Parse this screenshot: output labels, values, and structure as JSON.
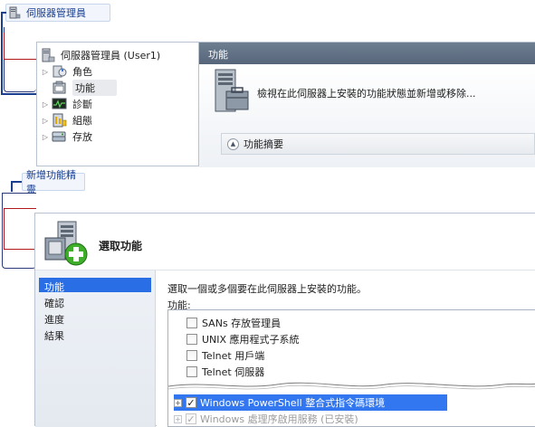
{
  "callout_top": {
    "label": "伺服器管理員"
  },
  "callout_bottom": {
    "label": "新增功能精靈"
  },
  "tree": {
    "root_label": "伺服器管理員 (User1)",
    "items": [
      {
        "label": "角色"
      },
      {
        "label": "功能"
      },
      {
        "label": "診斷"
      },
      {
        "label": "組態"
      },
      {
        "label": "存放"
      }
    ]
  },
  "detail": {
    "header_title": "功能",
    "description": "檢視在此伺服器上安裝的功能狀態並新增或移除...",
    "summary_label": "功能摘要"
  },
  "wizard": {
    "title": "選取功能",
    "nav": [
      {
        "label": "功能"
      },
      {
        "label": "確認"
      },
      {
        "label": "進度"
      },
      {
        "label": "結果"
      }
    ],
    "instruction": "選取一個或多個要在此伺服器上安裝的功能。",
    "list_label": "功能:",
    "features": [
      {
        "label": "SANs 存放管理員",
        "checked": false
      },
      {
        "label": "UNIX 應用程式子系統",
        "checked": false
      },
      {
        "label": "Telnet 用戶端",
        "checked": false
      },
      {
        "label": "Telnet 伺服器",
        "checked": false
      },
      {
        "label": "Windows PowerShell 整合式指令碼環境",
        "checked": true
      },
      {
        "label": "Windows 處理序啟用服務 (已安裝)",
        "checked": true
      }
    ]
  },
  "colors": {
    "selection_blue": "#3377f0",
    "nav_active": "#2a6ee6",
    "header_slate": "#5e6d81",
    "callout_navy": "#1b3f8f",
    "bracket_red": "#b0181c"
  }
}
